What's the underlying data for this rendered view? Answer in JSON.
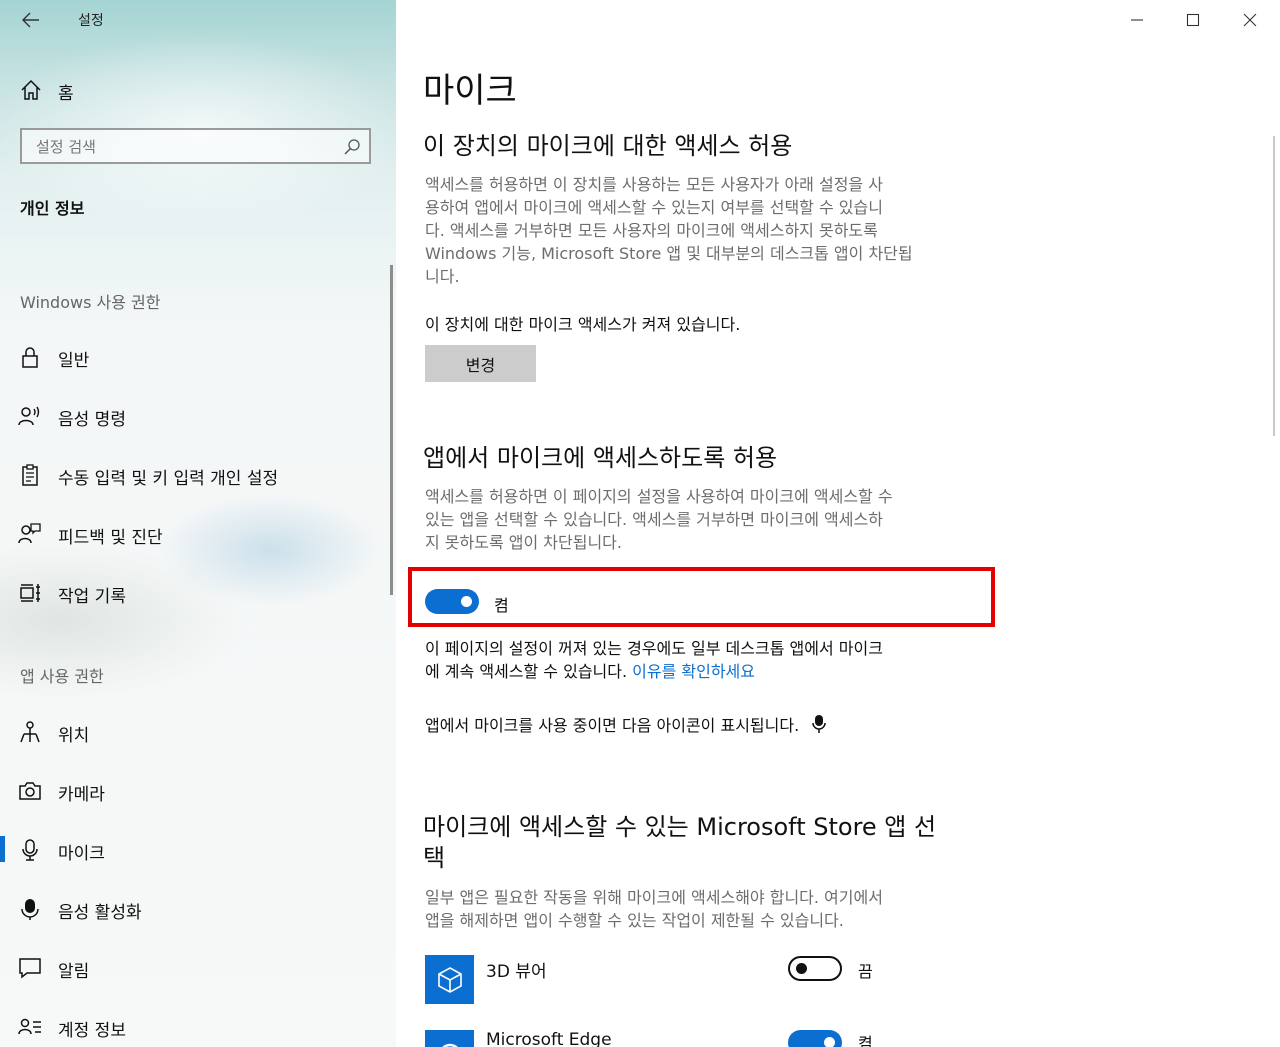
{
  "window": {
    "title": "설정"
  },
  "sidebar": {
    "home_label": "홈",
    "search_placeholder": "설정 검색",
    "category_title": "개인 정보",
    "windows_section": "Windows 사용 권한",
    "windows_items": [
      {
        "label": "일반",
        "icon": "lock-icon"
      },
      {
        "label": "음성 명령",
        "icon": "speech-icon"
      },
      {
        "label": "수동 입력 및 키 입력 개인 설정",
        "icon": "clipboard-icon"
      },
      {
        "label": "피드백 및 진단",
        "icon": "feedback-icon"
      },
      {
        "label": "작업 기록",
        "icon": "timeline-icon"
      }
    ],
    "app_section": "앱 사용 권한",
    "app_items": [
      {
        "label": "위치",
        "icon": "location-icon"
      },
      {
        "label": "카메라",
        "icon": "camera-icon"
      },
      {
        "label": "마이크",
        "icon": "microphone-icon",
        "selected": true
      },
      {
        "label": "음성 활성화",
        "icon": "voice-activation-icon"
      },
      {
        "label": "알림",
        "icon": "notification-icon"
      },
      {
        "label": "계정 정보",
        "icon": "account-info-icon"
      }
    ]
  },
  "main": {
    "title": "마이크",
    "device_section": {
      "heading": "이 장치의 마이크에 대한 액세스 허용",
      "desc_lines": [
        "액세스를 허용하면 이 장치를 사용하는 모든 사용자가 아래 설정을 사",
        "용하여 앱에서 마이크에 액세스할 수 있는지 여부를 선택할 수 있습니",
        "다. 액세스를 거부하면 모든 사용자의 마이크에 액세스하지 못하도록",
        "Windows 기능, Microsoft Store 앱 및 대부분의 데스크톱 앱이 차단됩",
        "니다."
      ],
      "status": "이 장치에 대한 마이크 액세스가 켜져 있습니다.",
      "change_button": "변경"
    },
    "app_section": {
      "heading": "앱에서 마이크에 액세스하도록 허용",
      "desc_lines": [
        "액세스를 허용하면 이 페이지의 설정을 사용하여 마이크에 액세스할 수",
        "있는 앱을 선택할 수 있습니다. 액세스를 거부하면 마이크에 액세스하",
        "지 못하도록 앱이 차단됩니다."
      ],
      "toggle_state": "on",
      "toggle_label": "켬",
      "note_line1": "이 페이지의 설정이 꺼져 있는 경우에도 일부 데스크톱 앱에서 마이크",
      "note_line2": "에 계속 액세스할 수 있습니다. ",
      "note_link": "이유를 확인하세요",
      "icon_note": "앱에서 마이크를 사용 중이면 다음 아이콘이 표시됩니다."
    },
    "store_section": {
      "heading_line1": "마이크에 액세스할 수 있는 Microsoft Store 앱 선",
      "heading_line2": "택",
      "desc_lines": [
        "일부 앱은 필요한 작동을 위해 마이크에 액세스해야 합니다. 여기에서",
        "앱을 해제하면 앱이 수행할 수 있는 작업이 제한될 수 있습니다."
      ],
      "apps": [
        {
          "name": "3D 뷰어",
          "toggle_state": "off",
          "toggle_label": "끔",
          "icon": "3d-viewer-icon"
        },
        {
          "name": "Microsoft Edge",
          "toggle_state": "on",
          "toggle_label": "켬",
          "icon": "edge-icon"
        }
      ]
    }
  },
  "colors": {
    "accent": "#0a6fd0",
    "highlight": "#e30000"
  }
}
